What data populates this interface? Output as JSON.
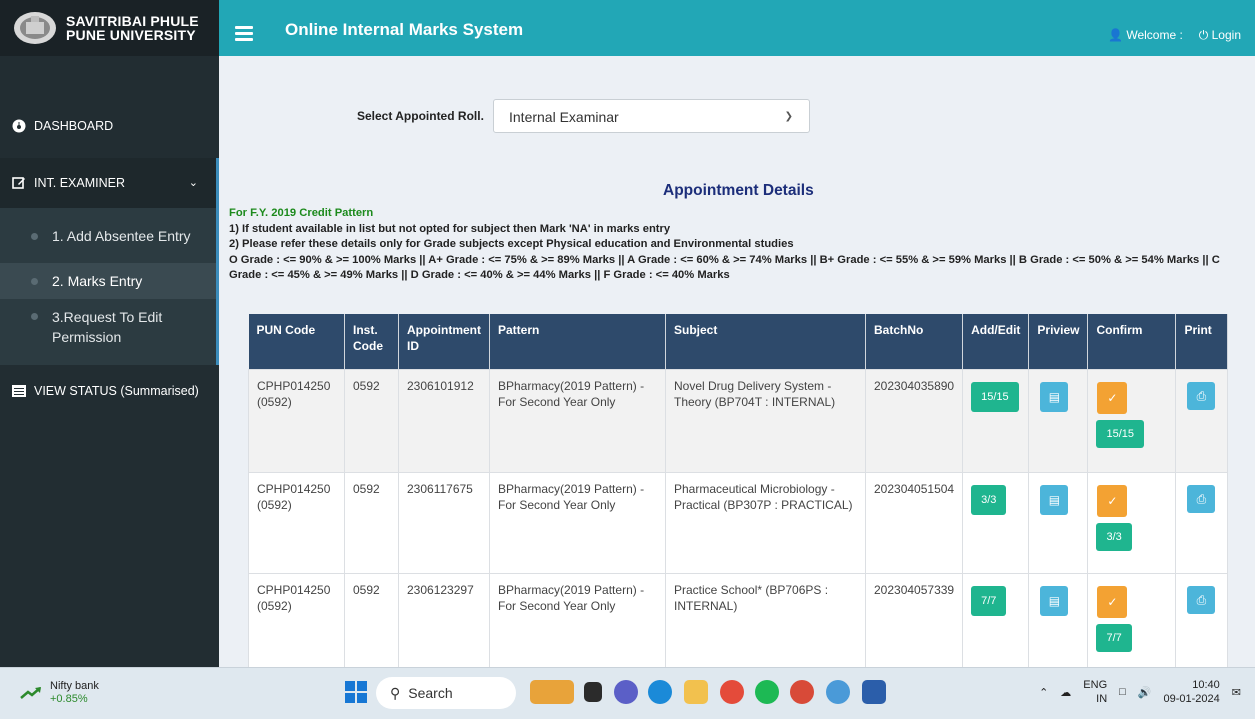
{
  "sidebar": {
    "brand_line1": "SAVITRIBAI PHULE",
    "brand_line2": "PUNE UNIVERSITY",
    "dashboard": "DASHBOARD",
    "int_examiner": "INT. EXAMINER",
    "submenu": [
      {
        "label": "1. Add Absentee Entry"
      },
      {
        "label": "2. Marks Entry"
      },
      {
        "label": "3.Request To Edit Permission"
      }
    ],
    "view_status": "VIEW STATUS (Summarised)"
  },
  "header": {
    "title": "Online Internal Marks System",
    "welcome": "Welcome :",
    "login": "Login"
  },
  "roll": {
    "label": "Select Appointed Roll.",
    "selected": "Internal Examinar"
  },
  "appointment_title": "Appointment Details",
  "info": {
    "pattern": "For F.Y. 2019 Credit Pattern",
    "line1": "1) If student available in list but not opted for subject then Mark 'NA' in marks entry",
    "line2": "2) Please refer these details only for Grade subjects except Physical education and Environmental studies",
    "line3": "O Grade : <= 90% & >= 100% Marks || A+ Grade : <= 75% & >= 89% Marks || A Grade : <= 60% & >= 74% Marks || B+ Grade : <= 55% & >= 59% Marks || B Grade : <= 50% & >= 54% Marks || C Grade : <= 45% & >= 49% Marks || D Grade : <= 40% & >= 44% Marks || F Grade : <= 40% Marks"
  },
  "table": {
    "headers": [
      "PUN Code",
      "Inst. Code",
      "Appointment ID",
      "Pattern",
      "Subject",
      "BatchNo",
      "Add/Edit",
      "Priview",
      "Confirm",
      "Print"
    ],
    "rows": [
      {
        "pun": "CPHP014250 (0592)",
        "inst": "0592",
        "appt": "2306101912",
        "pattern": "BPharmacy(2019 Pattern) - For Second Year Only",
        "subject": "Novel Drug Delivery System - Theory (BP704T : INTERNAL)",
        "batch": "202304035890",
        "addedit": "15/15",
        "confirm": "15/15"
      },
      {
        "pun": "CPHP014250 (0592)",
        "inst": "0592",
        "appt": "2306117675",
        "pattern": "BPharmacy(2019 Pattern) - For Second Year Only",
        "subject": "Pharmaceutical Microbiology - Practical (BP307P : PRACTICAL)",
        "batch": "202304051504",
        "addedit": "3/3",
        "confirm": "3/3"
      },
      {
        "pun": "CPHP014250 (0592)",
        "inst": "0592",
        "appt": "2306123297",
        "pattern": "BPharmacy(2019 Pattern) - For Second Year Only",
        "subject": "Practice School* (BP706PS : INTERNAL)",
        "batch": "202304057339",
        "addedit": "7/7",
        "confirm": "7/7"
      }
    ]
  },
  "taskbar": {
    "stock_name": "Nifty bank",
    "stock_change": "+0.85%",
    "search": "Search",
    "lang1": "ENG",
    "lang2": "IN",
    "time": "10:40",
    "date": "09-01-2024"
  }
}
